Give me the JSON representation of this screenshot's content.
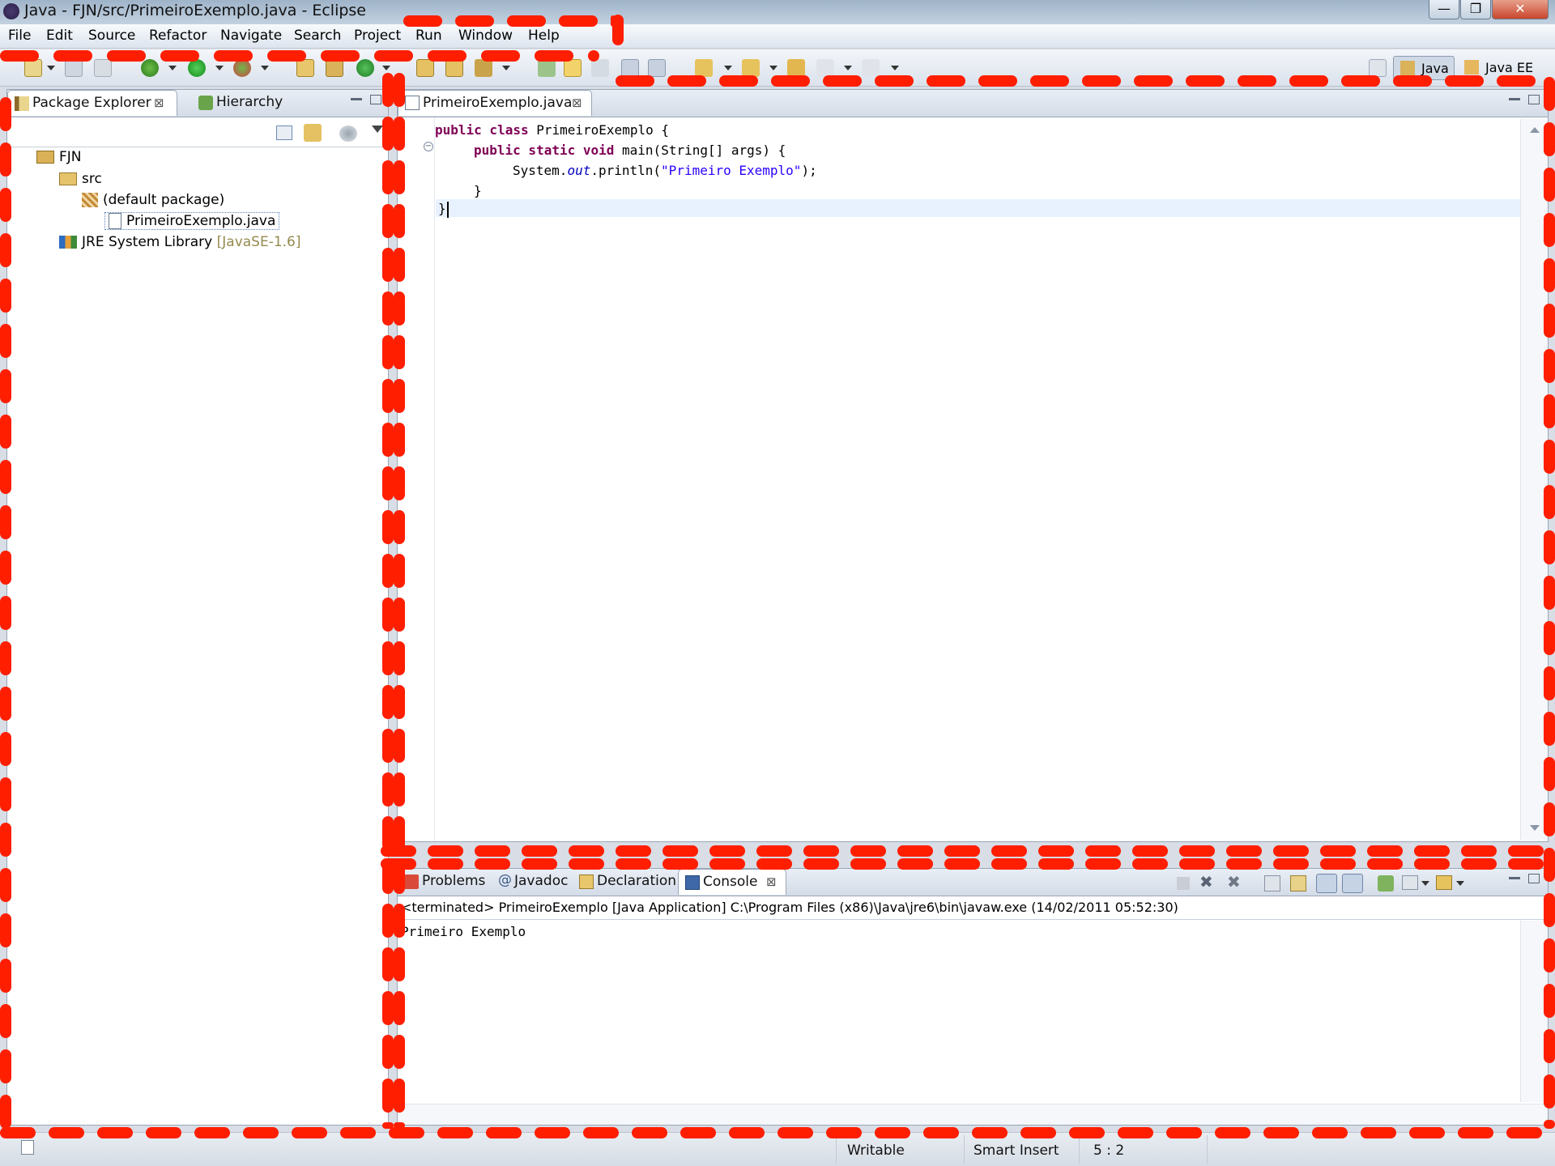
{
  "window": {
    "title": "Java - FJN/src/PrimeiroExemplo.java - Eclipse",
    "controls": {
      "minimize": "—",
      "restore": "❐",
      "close": "✕"
    }
  },
  "menu": [
    "File",
    "Edit",
    "Source",
    "Refactor",
    "Navigate",
    "Search",
    "Project",
    "Run",
    "Window",
    "Help"
  ],
  "perspectives": {
    "java": "Java",
    "java_ee": "Java EE"
  },
  "package_explorer": {
    "tabs": [
      "Package Explorer",
      "Hierarchy"
    ],
    "tree": {
      "project": "FJN",
      "src": "src",
      "package": "(default package)",
      "file": "PrimeiroExemplo.java",
      "library": "JRE System Library",
      "library_version": "[JavaSE-1.6]"
    }
  },
  "editor": {
    "tab": "PrimeiroExemplo.java",
    "code": {
      "l1_kw": "public class",
      "l1_rest": " PrimeiroExemplo {",
      "l2_kw": "public static void",
      "l2_rest": " main(String[] args) {",
      "l3_a": "System.",
      "l3_b": "out",
      "l3_c": ".println(",
      "l3_str": "\"Primeiro Exemplo\"",
      "l3_d": ");",
      "l4": "}",
      "l5": "}"
    }
  },
  "bottom_panel": {
    "tabs": [
      "Problems",
      "Javadoc",
      "Declaration",
      "Console"
    ],
    "status": "<terminated> PrimeiroExemplo [Java Application] C:\\Program Files (x86)\\Java\\jre6\\bin\\javaw.exe (14/02/2011 05:52:30)",
    "output": "Primeiro Exemplo"
  },
  "statusbar": {
    "writable": "Writable",
    "insert_mode": "Smart Insert",
    "position": "5 : 2"
  },
  "colors": {
    "highlight_dash": "#ff1e00",
    "keyword": "#7f0055",
    "string": "#2a00ff",
    "current_line": "#e8f2fe"
  }
}
